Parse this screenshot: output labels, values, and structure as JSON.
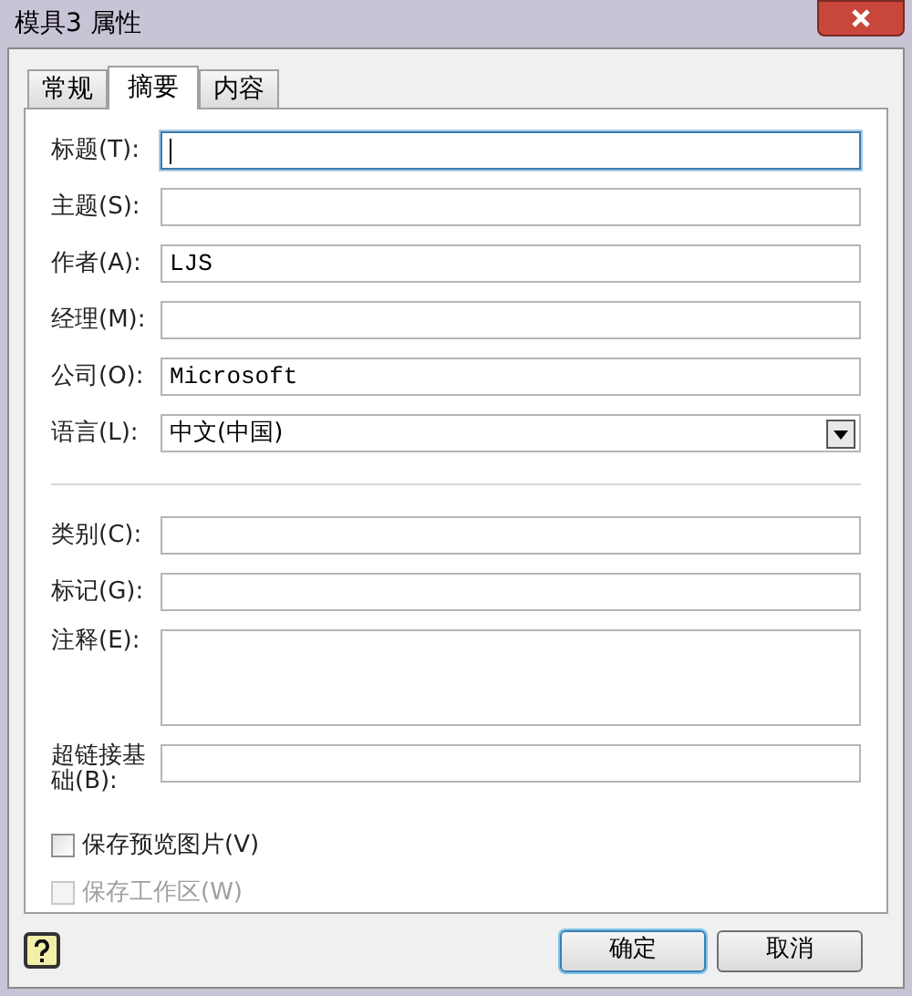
{
  "window": {
    "title": "模具3 属性"
  },
  "tabs": [
    {
      "label": "常规",
      "selected": false
    },
    {
      "label": "摘要",
      "selected": true
    },
    {
      "label": "内容",
      "selected": false
    }
  ],
  "fields": [
    {
      "label": "标题(T):",
      "kind": "text",
      "focused": true
    },
    {
      "label": "主题(S):",
      "kind": "text",
      "focused": false
    },
    {
      "label": "作者(A):",
      "kind": "text",
      "value": "LJS",
      "focused": false
    },
    {
      "label": "经理(M):",
      "kind": "text",
      "focused": false
    },
    {
      "label": "公司(O):",
      "kind": "text",
      "value": "Microsoft",
      "focused": false
    },
    {
      "label": "语言(L):",
      "kind": "select",
      "value": "中文(中国)"
    }
  ],
  "fields_2": [
    {
      "label": "类别(C):",
      "kind": "text",
      "focused": false
    },
    {
      "label": "标记(G):",
      "kind": "text",
      "focused": false
    },
    {
      "label": "注释(E):",
      "kind": "textarea",
      "focused": false
    },
    {
      "label": "超链接基础(B):",
      "kind": "text",
      "focused": false
    }
  ],
  "checkboxes": [
    {
      "label": "保存预览图片(V)",
      "checked": false,
      "disabled": false
    },
    {
      "label": "保存工作区(W)",
      "checked": false,
      "disabled": true
    }
  ],
  "buttons": [
    {
      "label": "确定",
      "default": true
    },
    {
      "label": "取消",
      "default": false
    }
  ]
}
